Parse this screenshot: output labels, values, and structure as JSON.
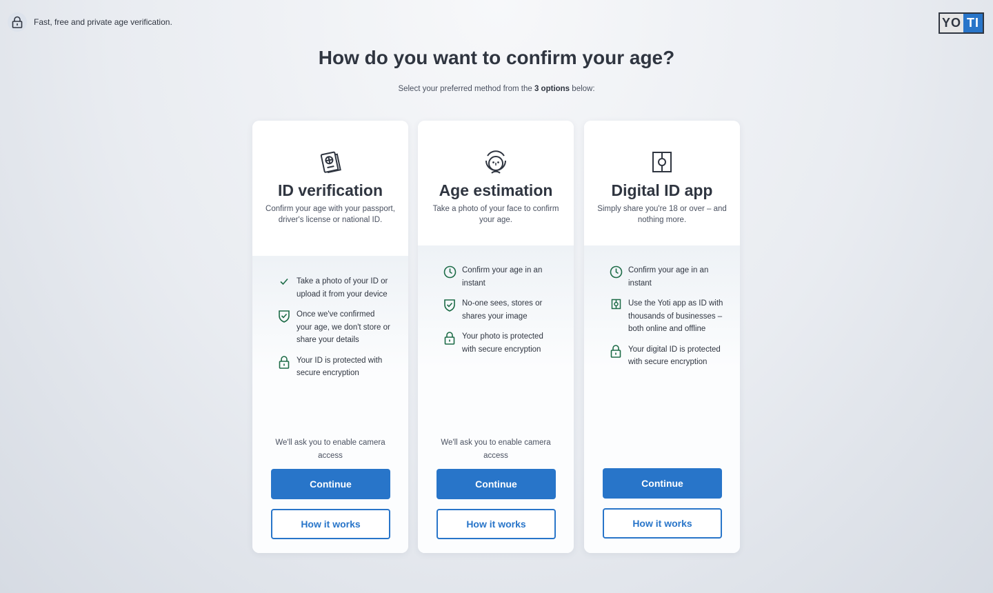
{
  "topbar": {
    "icon": "lock-icon",
    "tagline": "Fast, free and private age verification."
  },
  "logo": {
    "left": "YO",
    "right": "TI",
    "accent": "#2875c9",
    "dark": "#2f3540"
  },
  "page": {
    "title": "How do you want to confirm your age?",
    "subtitle_pre": "Select your preferred method from the",
    "subtitle_bold": "3 options",
    "subtitle_post": "below:"
  },
  "cards": [
    {
      "icon": "passport-icon",
      "title": "ID verification",
      "description": "Confirm your age with your passport, driver's license or national ID.",
      "features": [
        {
          "icon": "check-icon",
          "text": "Take a photo of your ID or upload it from your device"
        },
        {
          "icon": "shield-check-icon",
          "text": "Once we've confirmed your age, we don't store or share your details"
        },
        {
          "icon": "lock-icon",
          "text": "Your ID is protected with secure encryption"
        }
      ],
      "note": "We'll ask you to enable camera access",
      "primary_label": "Continue",
      "secondary_label": "How it works"
    },
    {
      "icon": "face-icon",
      "title": "Age estimation",
      "description": "Take a photo of your face to confirm your age.",
      "features": [
        {
          "icon": "clock-icon",
          "text": "Confirm your age in an instant"
        },
        {
          "icon": "shield-check-icon",
          "text": "No-one sees, stores or shares your image"
        },
        {
          "icon": "lock-icon",
          "text": "Your photo is protected with secure encryption"
        }
      ],
      "note": "We'll ask you to enable camera access",
      "primary_label": "Continue",
      "secondary_label": "How it works"
    },
    {
      "icon": "digital-id-icon",
      "title": "Digital ID app",
      "description": "Simply share you're 18 or over – and nothing more.",
      "features": [
        {
          "icon": "clock-icon",
          "text": "Confirm your age in an instant"
        },
        {
          "icon": "digital-id-icon",
          "text": "Use the Yoti app as ID with thousands of businesses – both online and offline"
        },
        {
          "icon": "lock-icon",
          "text": "Your digital ID is protected with secure encryption"
        }
      ],
      "note": "",
      "primary_label": "Continue",
      "secondary_label": "How it works"
    }
  ]
}
